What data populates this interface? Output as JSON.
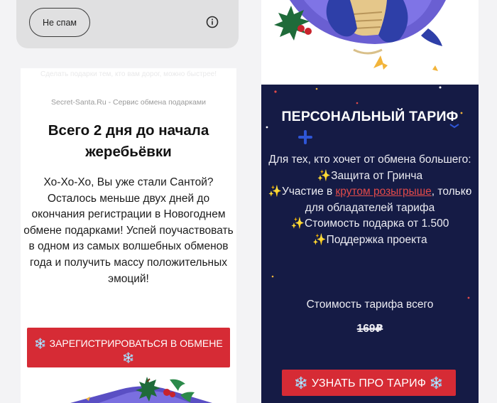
{
  "spam_bar": {
    "button_label": "Не спам",
    "info_icon": "info-circle-icon"
  },
  "email": {
    "preheader": "Сделать подарки тем, кто вам дорог, можно быстрее!",
    "sender": "Secret-Santa.Ru - Сервис обмена подарками",
    "headline": "Всего 2 дня до начала жеребьёвки",
    "body": "Хо-Хо-Хо, Вы уже стали Сантой? Осталось меньше двух дней до окончания регистрации в Новогоднем обмене подарками! Успей поучаствовать в одном из самых волшебных обменов года и получить массу положительных эмоций!",
    "register_button": "❄️ ЗАРЕГИСТРИРОВАТЬСЯ В ОБМЕНЕ ❄️"
  },
  "tariff": {
    "title": "ПЕРСОНАЛЬНЫЙ ТАРИФ",
    "intro": "Для тех, кто хочет от обмена большего:",
    "item_1": "✨Защита от Гринча",
    "item_2_prefix": "✨Участие в ",
    "item_2_link": "крутом розыгрыше",
    "item_2_suffix": ", только для обладателей тарифа",
    "item_3": "✨Стоимость подарка от 1.500",
    "item_4": "✨Поддержка проекта",
    "price_label": "Стоимость тарифа всего",
    "price": "169₽",
    "button": "❄️ УЗНАТЬ ПРО ТАРИФ ❄️"
  },
  "colors": {
    "accent_red": "#d62b35",
    "panel_navy": "#151b45",
    "link_red": "#e24a4a"
  }
}
